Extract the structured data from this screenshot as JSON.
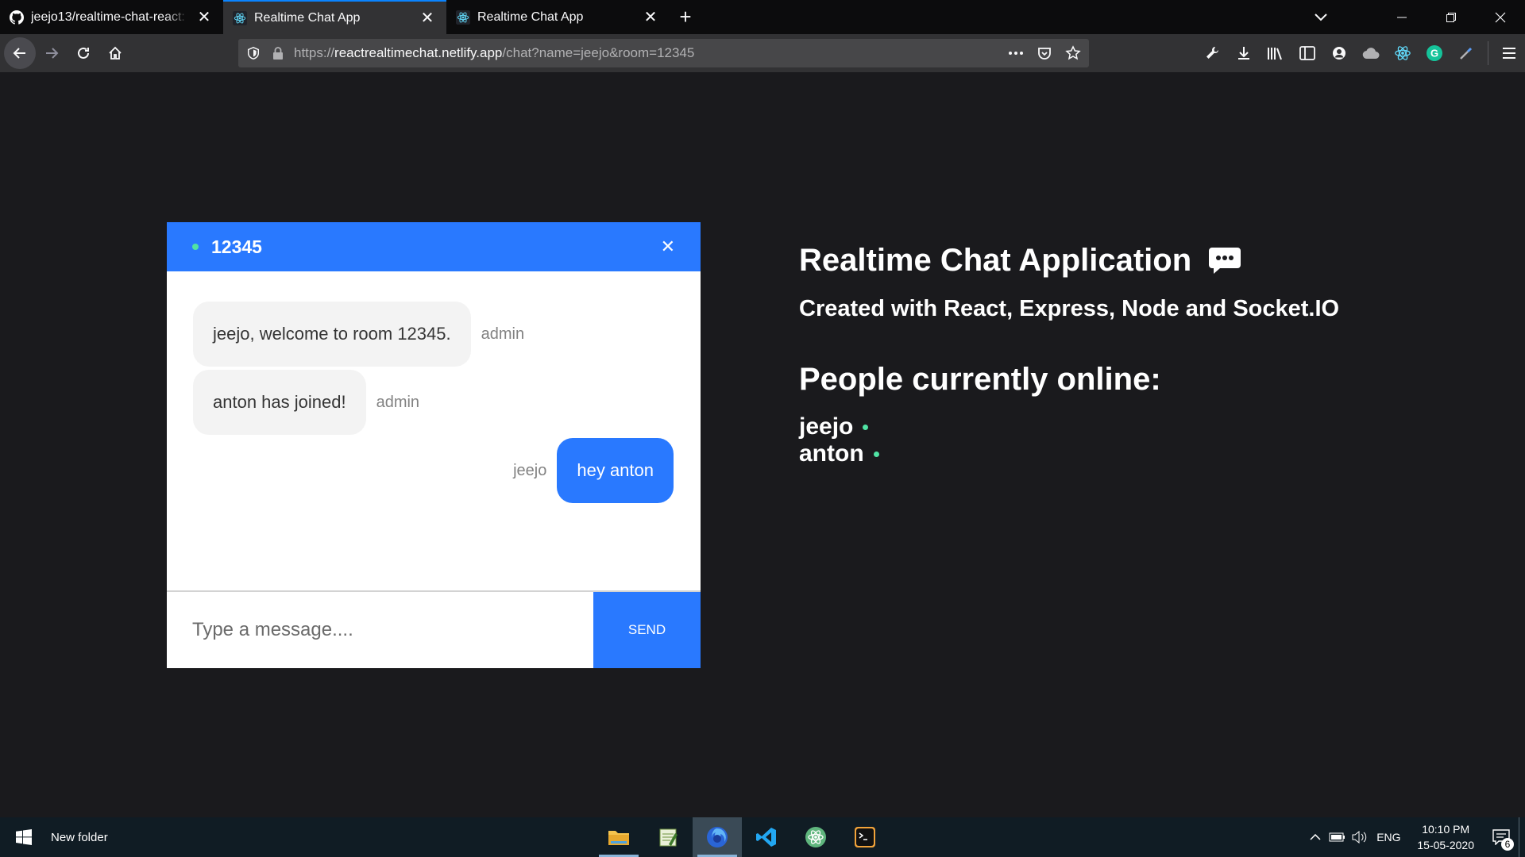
{
  "browser": {
    "tabs": [
      {
        "title": "jeejo13/realtime-chat-react: De",
        "icon": "github-icon",
        "active": false
      },
      {
        "title": "Realtime Chat App",
        "icon": "react-icon",
        "active": true
      },
      {
        "title": "Realtime Chat App",
        "icon": "react-icon",
        "active": false
      }
    ],
    "url": {
      "scheme": "https://",
      "host": "reactrealtimechat.netlify.app",
      "path": "/chat?name=jeejo&room=12345"
    },
    "new_tab_glyph": "+",
    "close_glyph": "✕"
  },
  "chat": {
    "room": "12345",
    "close_glyph": "✕",
    "messages": [
      {
        "text": "jeejo, welcome to room 12345.",
        "sender": "admin",
        "own": false
      },
      {
        "text": "anton has joined!",
        "sender": "admin",
        "own": false
      },
      {
        "text": "hey anton",
        "sender": "jeejo",
        "own": true
      }
    ],
    "input_placeholder": "Type a message....",
    "send_label": "SEND"
  },
  "info": {
    "title": "Realtime Chat Application",
    "title_icon": "speech-bubble-icon",
    "subtitle": "Created with React, Express, Node and Socket.IO",
    "online_heading": "People currently online:",
    "people": [
      "jeejo",
      "anton"
    ]
  },
  "taskbar": {
    "folder_label": "New folder",
    "apps": [
      "file-explorer-icon",
      "notepad-icon",
      "firefox-icon",
      "vscode-icon",
      "atom-icon",
      "terminal-icon"
    ],
    "language": "ENG",
    "time": "10:10 PM",
    "date": "15-05-2020",
    "notification_count": "6"
  },
  "colors": {
    "page_bg": "#1a1a1d",
    "accent": "#2979ff",
    "online": "#50e3a4"
  }
}
